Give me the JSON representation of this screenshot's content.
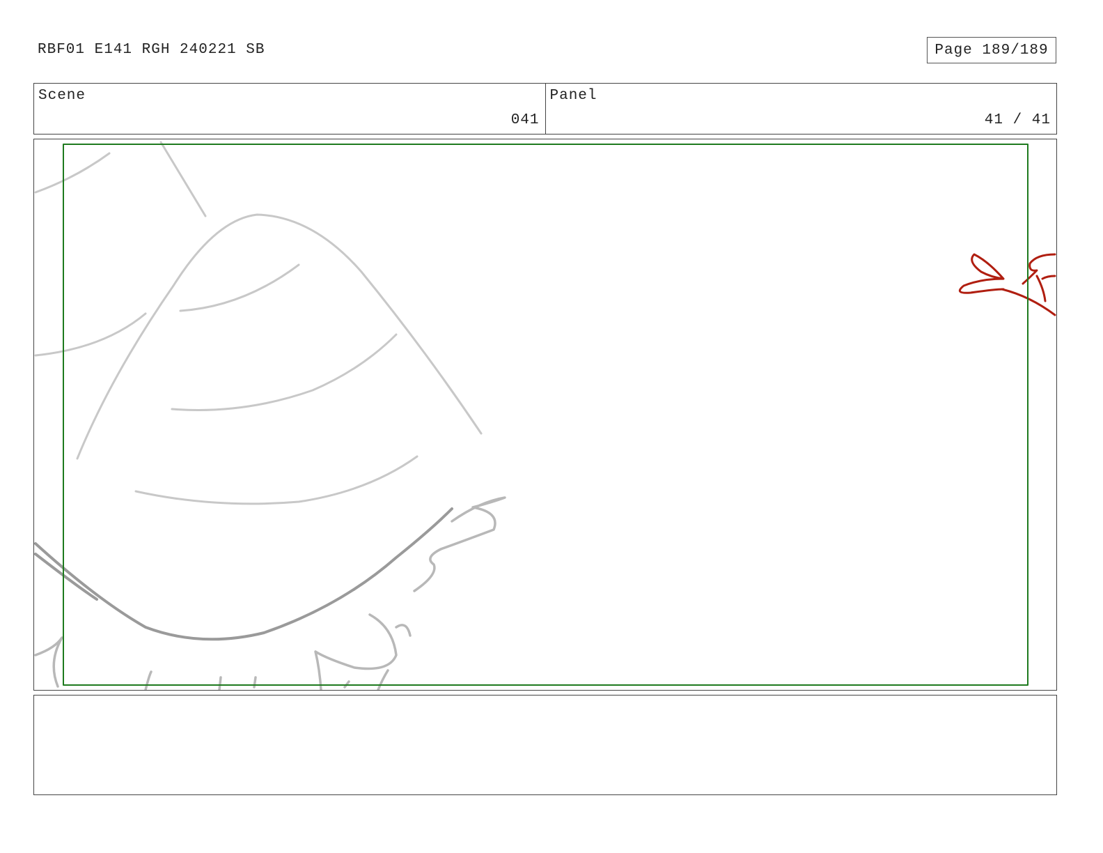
{
  "header": {
    "doc_title": "RBF01 E141 RGH 240221 SB",
    "page_label": "Page 189/189"
  },
  "info": {
    "scene_label": "Scene",
    "scene_value": "041",
    "panel_label": "Panel",
    "panel_value": "41 / 41"
  },
  "colors": {
    "safe_frame": "#1e7a1e",
    "sketch_gray": "#c8c8c8",
    "sketch_dark": "#9a9a9a",
    "sketch_red": "#b01e10"
  }
}
